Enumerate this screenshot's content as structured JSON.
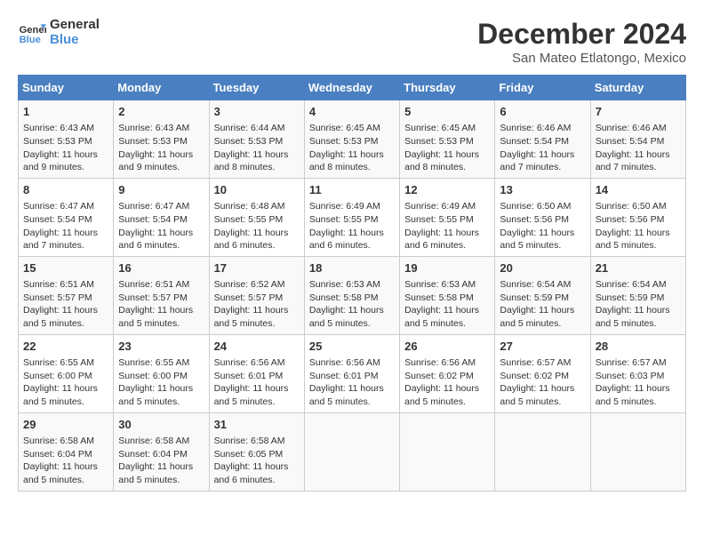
{
  "logo": {
    "line1": "General",
    "line2": "Blue"
  },
  "title": "December 2024",
  "subtitle": "San Mateo Etlatongo, Mexico",
  "weekdays": [
    "Sunday",
    "Monday",
    "Tuesday",
    "Wednesday",
    "Thursday",
    "Friday",
    "Saturday"
  ],
  "weeks": [
    [
      {
        "day": "1",
        "lines": [
          "Sunrise: 6:43 AM",
          "Sunset: 5:53 PM",
          "Daylight: 11 hours",
          "and 9 minutes."
        ]
      },
      {
        "day": "2",
        "lines": [
          "Sunrise: 6:43 AM",
          "Sunset: 5:53 PM",
          "Daylight: 11 hours",
          "and 9 minutes."
        ]
      },
      {
        "day": "3",
        "lines": [
          "Sunrise: 6:44 AM",
          "Sunset: 5:53 PM",
          "Daylight: 11 hours",
          "and 8 minutes."
        ]
      },
      {
        "day": "4",
        "lines": [
          "Sunrise: 6:45 AM",
          "Sunset: 5:53 PM",
          "Daylight: 11 hours",
          "and 8 minutes."
        ]
      },
      {
        "day": "5",
        "lines": [
          "Sunrise: 6:45 AM",
          "Sunset: 5:53 PM",
          "Daylight: 11 hours",
          "and 8 minutes."
        ]
      },
      {
        "day": "6",
        "lines": [
          "Sunrise: 6:46 AM",
          "Sunset: 5:54 PM",
          "Daylight: 11 hours",
          "and 7 minutes."
        ]
      },
      {
        "day": "7",
        "lines": [
          "Sunrise: 6:46 AM",
          "Sunset: 5:54 PM",
          "Daylight: 11 hours",
          "and 7 minutes."
        ]
      }
    ],
    [
      {
        "day": "8",
        "lines": [
          "Sunrise: 6:47 AM",
          "Sunset: 5:54 PM",
          "Daylight: 11 hours",
          "and 7 minutes."
        ]
      },
      {
        "day": "9",
        "lines": [
          "Sunrise: 6:47 AM",
          "Sunset: 5:54 PM",
          "Daylight: 11 hours",
          "and 6 minutes."
        ]
      },
      {
        "day": "10",
        "lines": [
          "Sunrise: 6:48 AM",
          "Sunset: 5:55 PM",
          "Daylight: 11 hours",
          "and 6 minutes."
        ]
      },
      {
        "day": "11",
        "lines": [
          "Sunrise: 6:49 AM",
          "Sunset: 5:55 PM",
          "Daylight: 11 hours",
          "and 6 minutes."
        ]
      },
      {
        "day": "12",
        "lines": [
          "Sunrise: 6:49 AM",
          "Sunset: 5:55 PM",
          "Daylight: 11 hours",
          "and 6 minutes."
        ]
      },
      {
        "day": "13",
        "lines": [
          "Sunrise: 6:50 AM",
          "Sunset: 5:56 PM",
          "Daylight: 11 hours",
          "and 5 minutes."
        ]
      },
      {
        "day": "14",
        "lines": [
          "Sunrise: 6:50 AM",
          "Sunset: 5:56 PM",
          "Daylight: 11 hours",
          "and 5 minutes."
        ]
      }
    ],
    [
      {
        "day": "15",
        "lines": [
          "Sunrise: 6:51 AM",
          "Sunset: 5:57 PM",
          "Daylight: 11 hours",
          "and 5 minutes."
        ]
      },
      {
        "day": "16",
        "lines": [
          "Sunrise: 6:51 AM",
          "Sunset: 5:57 PM",
          "Daylight: 11 hours",
          "and 5 minutes."
        ]
      },
      {
        "day": "17",
        "lines": [
          "Sunrise: 6:52 AM",
          "Sunset: 5:57 PM",
          "Daylight: 11 hours",
          "and 5 minutes."
        ]
      },
      {
        "day": "18",
        "lines": [
          "Sunrise: 6:53 AM",
          "Sunset: 5:58 PM",
          "Daylight: 11 hours",
          "and 5 minutes."
        ]
      },
      {
        "day": "19",
        "lines": [
          "Sunrise: 6:53 AM",
          "Sunset: 5:58 PM",
          "Daylight: 11 hours",
          "and 5 minutes."
        ]
      },
      {
        "day": "20",
        "lines": [
          "Sunrise: 6:54 AM",
          "Sunset: 5:59 PM",
          "Daylight: 11 hours",
          "and 5 minutes."
        ]
      },
      {
        "day": "21",
        "lines": [
          "Sunrise: 6:54 AM",
          "Sunset: 5:59 PM",
          "Daylight: 11 hours",
          "and 5 minutes."
        ]
      }
    ],
    [
      {
        "day": "22",
        "lines": [
          "Sunrise: 6:55 AM",
          "Sunset: 6:00 PM",
          "Daylight: 11 hours",
          "and 5 minutes."
        ]
      },
      {
        "day": "23",
        "lines": [
          "Sunrise: 6:55 AM",
          "Sunset: 6:00 PM",
          "Daylight: 11 hours",
          "and 5 minutes."
        ]
      },
      {
        "day": "24",
        "lines": [
          "Sunrise: 6:56 AM",
          "Sunset: 6:01 PM",
          "Daylight: 11 hours",
          "and 5 minutes."
        ]
      },
      {
        "day": "25",
        "lines": [
          "Sunrise: 6:56 AM",
          "Sunset: 6:01 PM",
          "Daylight: 11 hours",
          "and 5 minutes."
        ]
      },
      {
        "day": "26",
        "lines": [
          "Sunrise: 6:56 AM",
          "Sunset: 6:02 PM",
          "Daylight: 11 hours",
          "and 5 minutes."
        ]
      },
      {
        "day": "27",
        "lines": [
          "Sunrise: 6:57 AM",
          "Sunset: 6:02 PM",
          "Daylight: 11 hours",
          "and 5 minutes."
        ]
      },
      {
        "day": "28",
        "lines": [
          "Sunrise: 6:57 AM",
          "Sunset: 6:03 PM",
          "Daylight: 11 hours",
          "and 5 minutes."
        ]
      }
    ],
    [
      {
        "day": "29",
        "lines": [
          "Sunrise: 6:58 AM",
          "Sunset: 6:04 PM",
          "Daylight: 11 hours",
          "and 5 minutes."
        ]
      },
      {
        "day": "30",
        "lines": [
          "Sunrise: 6:58 AM",
          "Sunset: 6:04 PM",
          "Daylight: 11 hours",
          "and 5 minutes."
        ]
      },
      {
        "day": "31",
        "lines": [
          "Sunrise: 6:58 AM",
          "Sunset: 6:05 PM",
          "Daylight: 11 hours",
          "and 6 minutes."
        ]
      },
      null,
      null,
      null,
      null
    ]
  ]
}
